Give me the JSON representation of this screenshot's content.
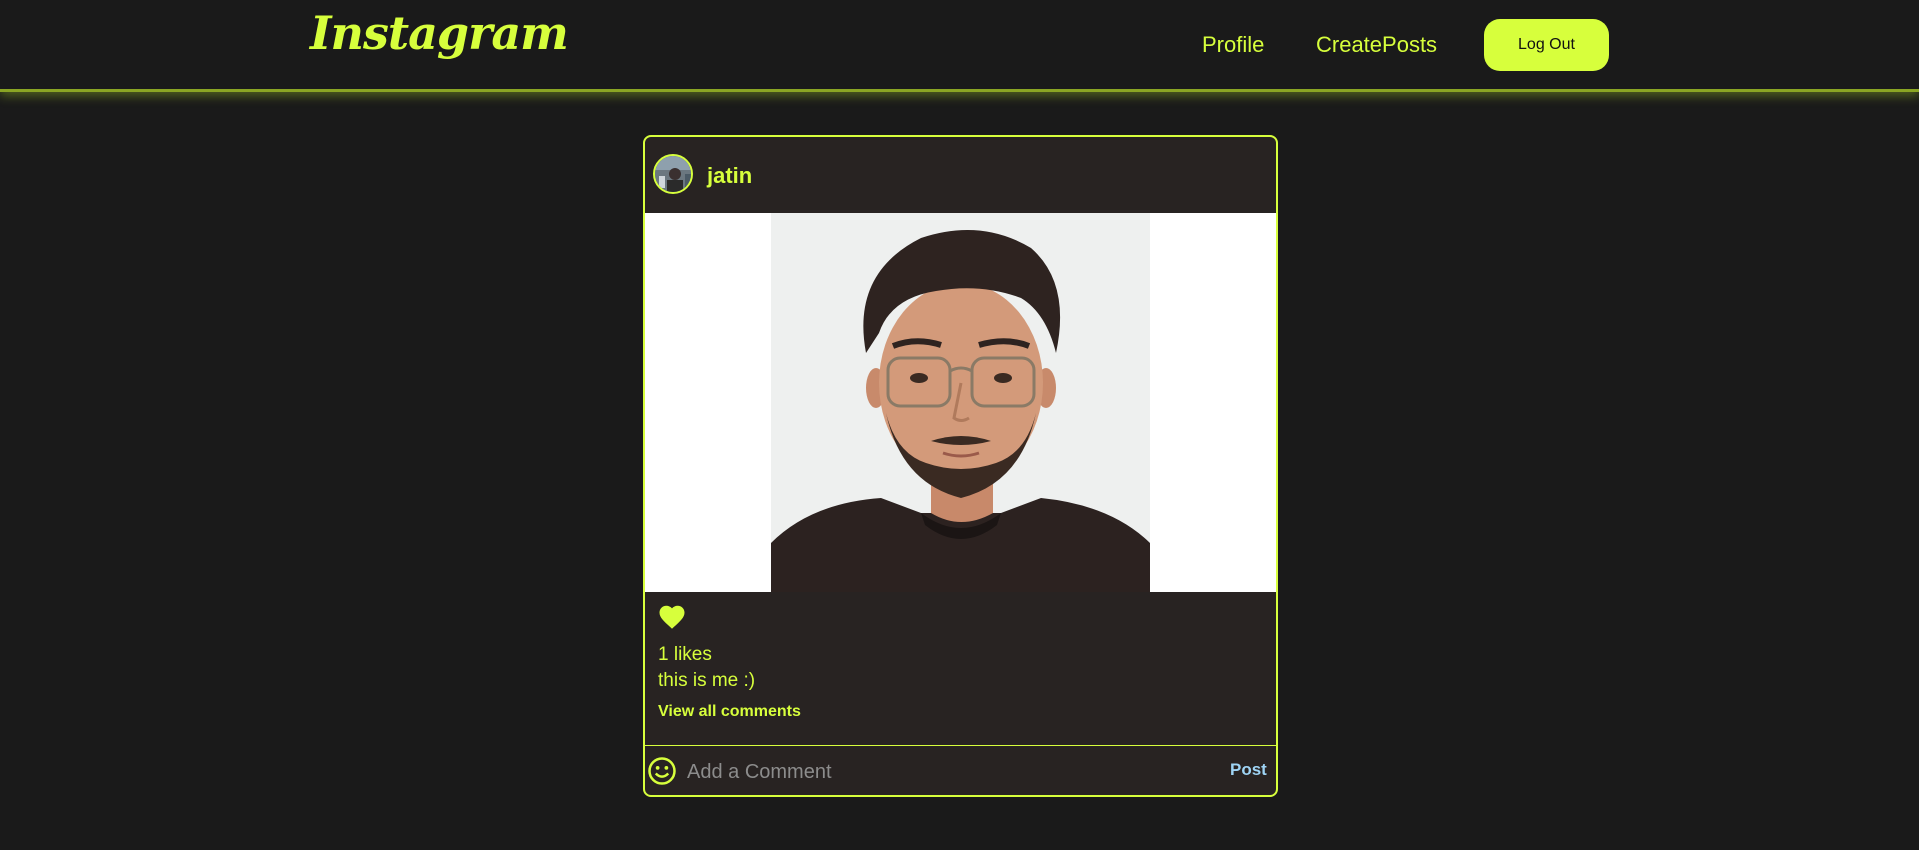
{
  "header": {
    "logo_text": "Instagram",
    "nav": [
      {
        "label": "Profile"
      },
      {
        "label": "CreatePosts"
      }
    ],
    "logout_label": "Log Out"
  },
  "post": {
    "username": "jatin",
    "likes_text": "1 likes",
    "caption": "this is me :)",
    "view_comments_label": "View all comments",
    "comment_placeholder": "Add a Comment",
    "post_label": "Post"
  },
  "theme": {
    "accent": "#d7ff3c",
    "background": "#1a1a1a",
    "card_background": "#282322",
    "post_button_color": "#9fd4f5"
  },
  "icons": {
    "like": "heart-icon",
    "emoji": "smile-icon"
  }
}
